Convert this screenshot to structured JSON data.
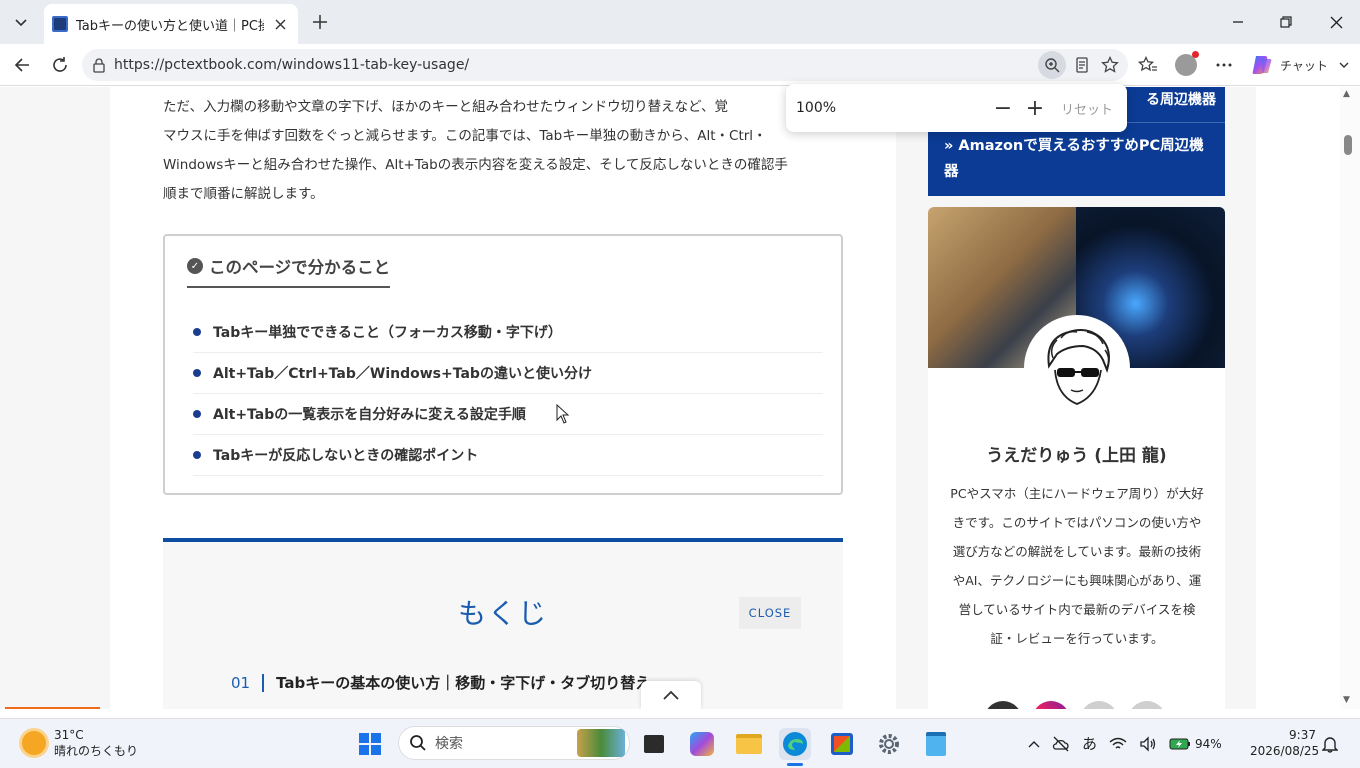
{
  "browser": {
    "tab_title": "Tabキーの使い方と使い道｜PC操作を",
    "url": "https://pctextbook.com/windows11-tab-key-usage/",
    "copilot_label": "チャット"
  },
  "zoom_popup": {
    "value": "100%",
    "minus": "−",
    "plus": "+",
    "reset": "リセット"
  },
  "article": {
    "intro_lines": [
      "ただ、入力欄の移動や文章の字下げ、ほかのキーと組み合わせたウィンドウ切り替えなど、覚",
      "マウスに手を伸ばす回数をぐっと減らせます。この記事では、Tabキー単独の動きから、Alt・Ctrl・",
      "Windowsキーと組み合わせた操作、Alt+Tabの表示内容を変える設定、そして反応しないときの確認手",
      "順まで順番に解説します。"
    ],
    "point_box": {
      "title": "このページで分かること",
      "items": [
        "Tabキー単独でできること（フォーカス移動・字下げ）",
        "Alt+Tab／Ctrl+Tab／Windows+Tabの違いと使い分け",
        "Alt+Tabの一覧表示を自分好みに変える設定手順",
        "Tabキーが反応しないときの確認ポイント"
      ]
    },
    "toc": {
      "title": "もくじ",
      "close": "CLOSE",
      "first_num": "01",
      "first_item": "Tabキーの基本の使い方｜移動・字下げ・タブ切り替え"
    }
  },
  "sidebar": {
    "link1": "る周辺機器",
    "link2": "» Amazonで買えるおすすめPC周辺機器",
    "author_name": "うえだりゅう (上田 龍)",
    "author_desc": "PCやスマホ（主にハードウェア周り）が大好きです。このサイトではパソコンの使い方や選び方などの解説をしています。最新の技術やAI、テクノロジーにも興味関心があり、運営しているサイト内で最新のデバイスを検証・レビューを行っています。"
  },
  "taskbar": {
    "temperature": "31°C",
    "weather": "晴れのちくもり",
    "search_label": "検索",
    "ime": "あ",
    "battery": "94%",
    "time": "9:37",
    "date": "2026/08/25"
  },
  "colors": {
    "accent_blue": "#0b3b94",
    "toc_blue": "#1a5db0",
    "progress_orange": "#ef6a1a"
  }
}
